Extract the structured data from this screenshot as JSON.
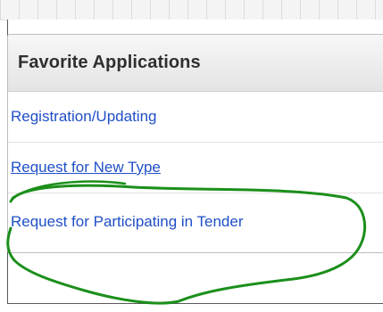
{
  "widget": {
    "title": "Favorite Applications",
    "items": [
      {
        "label": "Registration/Updating"
      },
      {
        "label": "Request for New Type"
      },
      {
        "label": "Request for Participating in Tender"
      }
    ]
  },
  "colors": {
    "link": "#1f4fc7",
    "annotation_circle": "#1b8f1b",
    "header_bg": "#e9e9e9"
  },
  "annotation": {
    "shape": "hand-drawn-circle",
    "highlights": "Request for Participating in Tender"
  }
}
